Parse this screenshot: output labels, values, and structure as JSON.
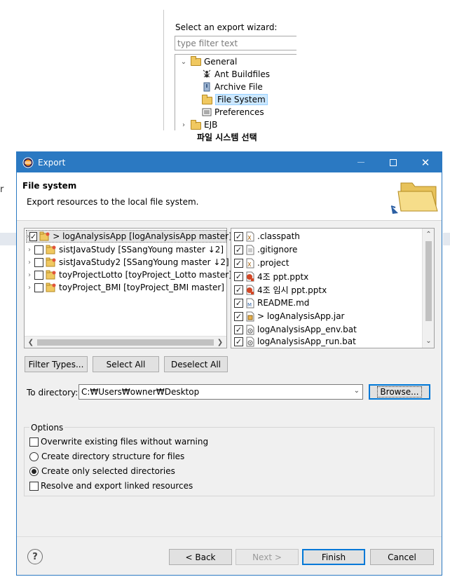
{
  "wizard": {
    "label": "Select an export wizard:",
    "filter_placeholder": "type filter text",
    "tree": [
      {
        "label": "General",
        "expanded": true,
        "icon": "folder-open-icon"
      },
      {
        "label": "Ant Buildfiles",
        "icon": "ant-icon"
      },
      {
        "label": "Archive File",
        "icon": "archive-icon"
      },
      {
        "label": "File System",
        "icon": "folder-icon",
        "selected": true
      },
      {
        "label": "Preferences",
        "icon": "preferences-icon"
      },
      {
        "label": "EJB",
        "expanded": false,
        "icon": "folder-icon"
      }
    ],
    "caption": "파일 시스템 선택"
  },
  "left_crop_text": "r",
  "dialog": {
    "title": "Export",
    "header": {
      "title": "File system",
      "description": "Export resources to the local file system."
    },
    "projects": [
      {
        "label": "> logAnalysisApp [logAnalysisApp master]",
        "checked": true,
        "selected": true
      },
      {
        "label": "sistJavaStudy [SSangYoung master ↓2]",
        "checked": false
      },
      {
        "label": "sistJavaStudy2 [SSangYoung master ↓2]",
        "checked": false
      },
      {
        "label": "toyProjectLotto [toyProject_Lotto master]",
        "checked": false
      },
      {
        "label": "toyProject_BMI [toyProject_BMI master]",
        "checked": false
      }
    ],
    "files": [
      {
        "label": ".classpath",
        "checked": true,
        "icon": "xml-file-icon"
      },
      {
        "label": ".gitignore",
        "checked": true,
        "icon": "text-file-icon"
      },
      {
        "label": ".project",
        "checked": true,
        "icon": "xml-file-icon"
      },
      {
        "label": "4조 ppt.pptx",
        "checked": true,
        "icon": "pptx-file-icon"
      },
      {
        "label": "4조 임시 ppt.pptx",
        "checked": true,
        "icon": "pptx-file-icon"
      },
      {
        "label": "README.md",
        "checked": true,
        "icon": "markdown-file-icon"
      },
      {
        "label": "> logAnalysisApp.jar",
        "checked": true,
        "icon": "jar-file-icon"
      },
      {
        "label": "logAnalysisApp_env.bat",
        "checked": true,
        "icon": "bat-file-icon"
      },
      {
        "label": "logAnalysisApp_run.bat",
        "checked": true,
        "icon": "bat-file-icon"
      }
    ],
    "buttons": {
      "filter_types": "Filter Types...",
      "select_all": "Select All",
      "deselect_all": "Deselect All",
      "browse": "Browse...",
      "back": "< Back",
      "next": "Next >",
      "finish": "Finish",
      "cancel": "Cancel"
    },
    "to_directory": {
      "label": "To directory:",
      "value": "C:₩Users₩owner₩Desktop"
    },
    "options": {
      "legend": "Options",
      "overwrite": {
        "label": "Overwrite existing files without warning",
        "checked": false
      },
      "create_structure": {
        "label": "Create directory structure for files",
        "selected": false
      },
      "create_selected": {
        "label": "Create only selected directories",
        "selected": true
      },
      "resolve_linked": {
        "label": "Resolve and export linked resources",
        "checked": false
      }
    },
    "colors": {
      "titlebar": "#2b79c2",
      "default_button_border": "#0078d7"
    }
  }
}
